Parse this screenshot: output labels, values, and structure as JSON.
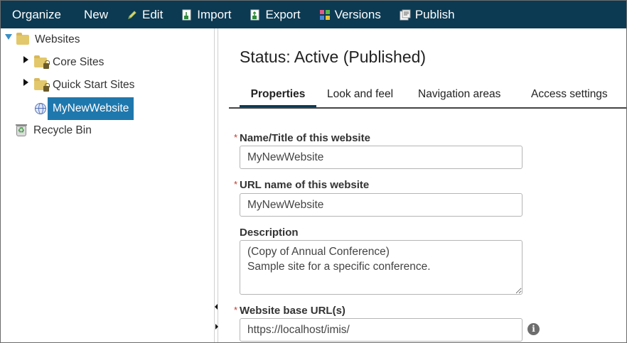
{
  "toolbar": {
    "items": [
      {
        "label": "Organize",
        "icon": ""
      },
      {
        "label": "New",
        "icon": ""
      },
      {
        "label": "Edit",
        "icon": "pencil-icon"
      },
      {
        "label": "Import",
        "icon": "import-icon"
      },
      {
        "label": "Export",
        "icon": "export-icon"
      },
      {
        "label": "Versions",
        "icon": "versions-icon"
      },
      {
        "label": "Publish",
        "icon": "publish-icon"
      }
    ]
  },
  "tree": {
    "root": "Websites",
    "children": [
      "Core Sites",
      "Quick Start Sites",
      "MyNewWebsite"
    ],
    "recycle": "Recycle Bin",
    "selected": "MyNewWebsite"
  },
  "main": {
    "status": "Status: Active (Published)",
    "tabs": [
      "Properties",
      "Look and feel",
      "Navigation areas",
      "Access settings"
    ],
    "active_tab": "Properties",
    "fields": {
      "name": {
        "label": "Name/Title of this website",
        "value": "MyNewWebsite",
        "required": "*"
      },
      "url": {
        "label": "URL name of this website",
        "value": "MyNewWebsite",
        "required": "*"
      },
      "description": {
        "label": "Description",
        "value": "(Copy of Annual Conference)\nSample site for a specific conference."
      },
      "base_url": {
        "label": "Website base URL(s)",
        "value": "https://localhost/imis/",
        "required": "*"
      }
    },
    "info_glyph": "i"
  },
  "colors": {
    "toolbar_bg": "#0c3a52",
    "selected_bg": "#1f78ad",
    "required": "#c0392b"
  }
}
